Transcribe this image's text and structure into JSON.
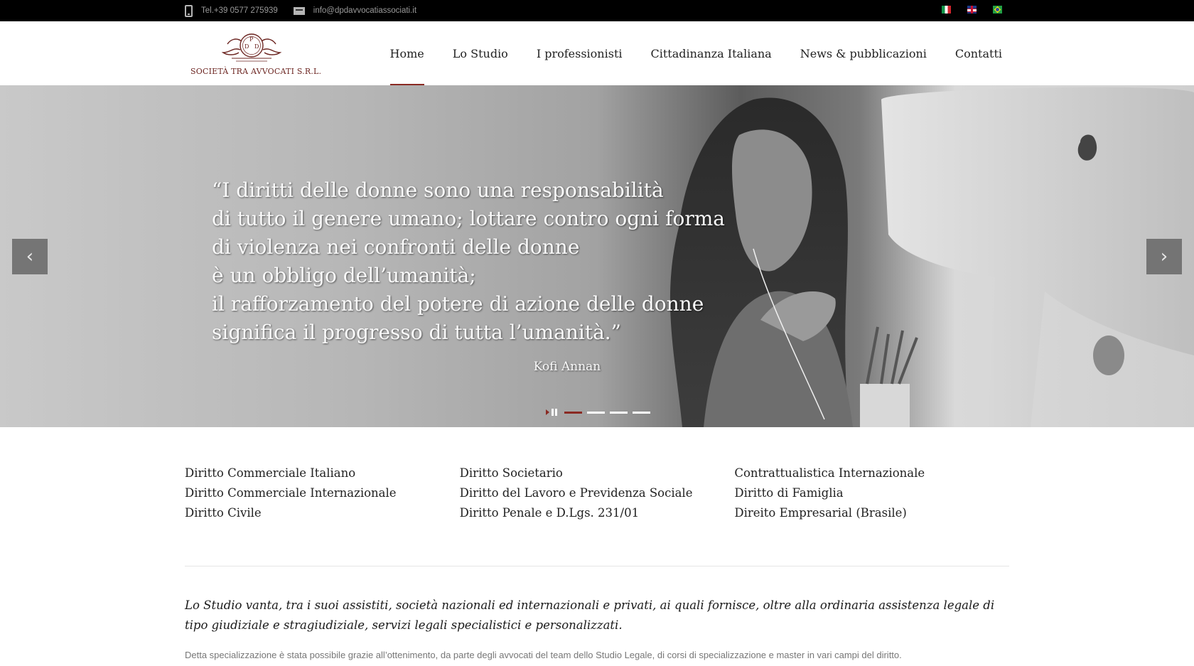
{
  "topbar": {
    "phone": "Tel.+39 0577 275939",
    "email": "info@dpdavvocatiassociati.it",
    "languages": [
      "Italiano",
      "English",
      "Português"
    ]
  },
  "logo": {
    "text": "SOCIETÀ TRA AVVOCATI S.R.L.",
    "color": "#6b2420"
  },
  "nav": {
    "items": [
      "Home",
      "Lo Studio",
      "I professionisti",
      "Cittadinanza Italiana",
      "News & pubblicazioni",
      "Contatti"
    ],
    "active": "Home",
    "accent": "#8a2a23"
  },
  "hero": {
    "quote_lines": [
      "“I diritti delle donne sono una responsabilità",
      "di tutto il genere umano; lottare contro ogni forma",
      "di violenza nei confronti delle donne",
      "è un obbligo dell’umanità;",
      "il rafforzamento del potere di azione delle donne",
      "significa il progresso di tutta l’umanità.”"
    ],
    "author": "Kofi Annan",
    "slide_count": 4,
    "active_slide": 1
  },
  "areas": {
    "columns": [
      [
        "Diritto Commerciale Italiano",
        "Diritto Commerciale Internazionale",
        "Diritto Civile"
      ],
      [
        "Diritto Societario",
        "Diritto del Lavoro e Previdenza Sociale",
        "Diritto Penale e D.Lgs. 231/01"
      ],
      [
        "Contrattualistica Internazionale",
        "Diritto di Famiglia",
        "Direito Empresarial (Brasile)"
      ]
    ]
  },
  "intro": "Lo Studio vanta, tra i suoi assistiti, società nazionali ed internazionali e privati, ai quali fornisce, oltre alla ordinaria assistenza legale di tipo giudiziale e stragiudiziale, servizi legali specialistici e personalizzati.",
  "detail": "Detta specializzazione è stata possibile grazie all’ottenimento, da parte degli avvocati del team dello Studio Legale, di corsi di specializzazione e master in vari campi del diritto."
}
